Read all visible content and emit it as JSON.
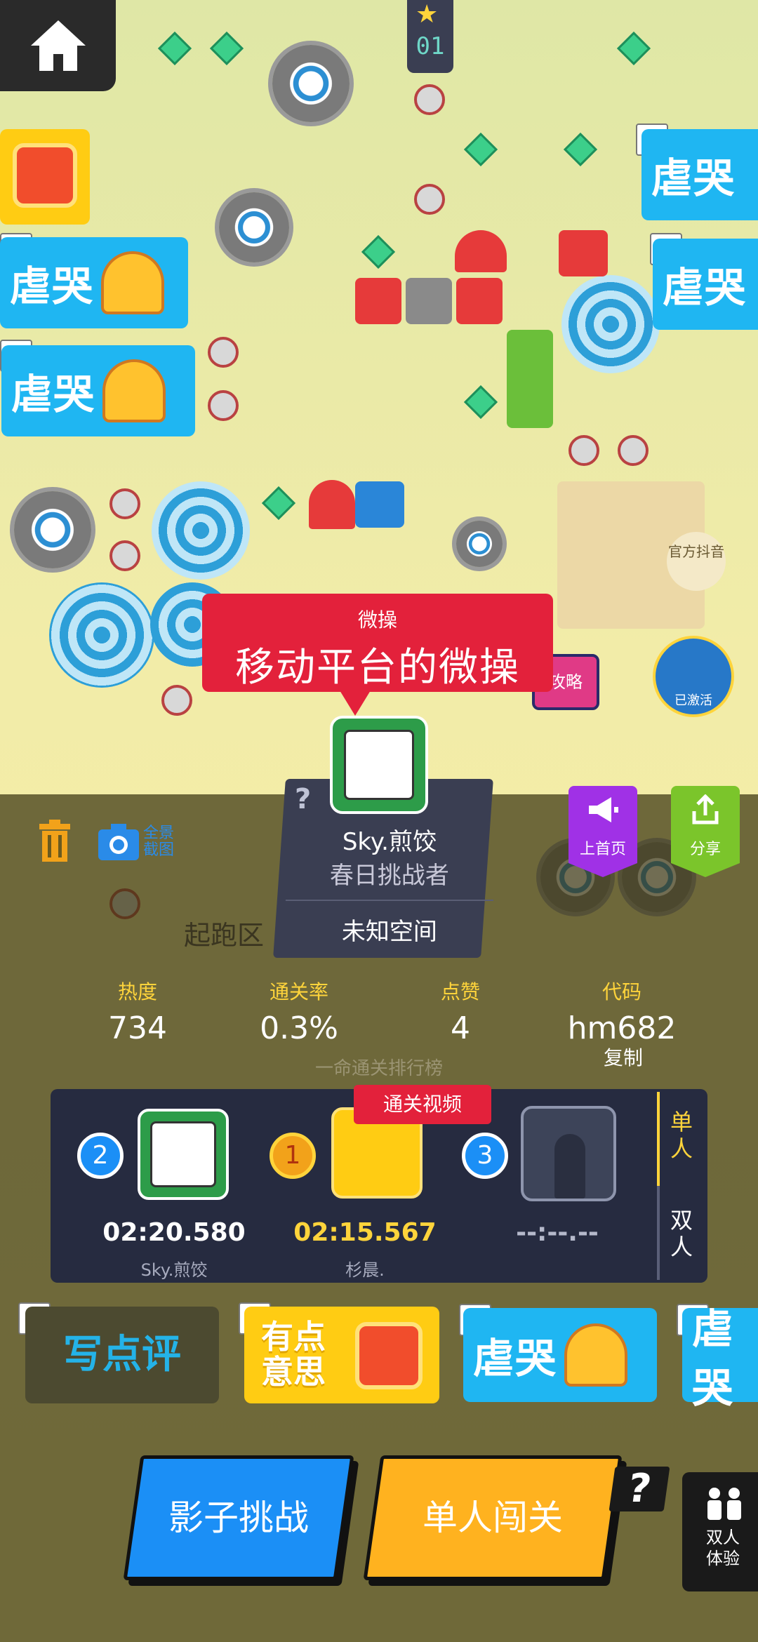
{
  "header": {
    "level_counter": "01"
  },
  "stickers": {
    "cry": "虐哭",
    "interesting": "有点意思"
  },
  "map": {
    "official_badge": "官方抖音",
    "guide_tv": "攻略",
    "activated_badge": "已激活",
    "start_zone": "起跑区"
  },
  "level": {
    "category": "微操",
    "title": "移动平台的微操"
  },
  "creator": {
    "help": "?",
    "name": "Sky.煎饺",
    "rank": "春日挑战者",
    "space": "未知空间"
  },
  "actions": {
    "screenshot_label": "全景截图",
    "prev_label": "上首页",
    "share_label": "分享"
  },
  "stats": {
    "heat_label": "热度",
    "heat_value": "734",
    "pass_rate_label": "通关率",
    "pass_rate_value": "0.3%",
    "likes_label": "点赞",
    "likes_value": "4",
    "code_label": "代码",
    "code_value": "hm682",
    "copy_label": "复制"
  },
  "leaderboard": {
    "title": "一命通关排行榜",
    "video_tag": "通关视频",
    "entries": [
      {
        "rank": "2",
        "time": "02:20.580",
        "name": "Sky.煎饺"
      },
      {
        "rank": "1",
        "time": "02:15.567",
        "name": "杉晨."
      },
      {
        "rank": "3",
        "time": "--:--.--",
        "name": ""
      }
    ],
    "mode_single": "单人",
    "mode_double": "双人"
  },
  "comments": {
    "review_button": "写点评"
  },
  "buttons": {
    "shadow_challenge": "影子挑战",
    "solo_play": "单人闯关",
    "solo_help": "?",
    "duo_trial": "双人体验"
  },
  "colors": {
    "accent_red": "#e3213b",
    "accent_blue": "#1b8ff6",
    "accent_yellow": "#ffb21f",
    "panel_dark": "#262b40",
    "stat_label": "#ffd43b"
  }
}
